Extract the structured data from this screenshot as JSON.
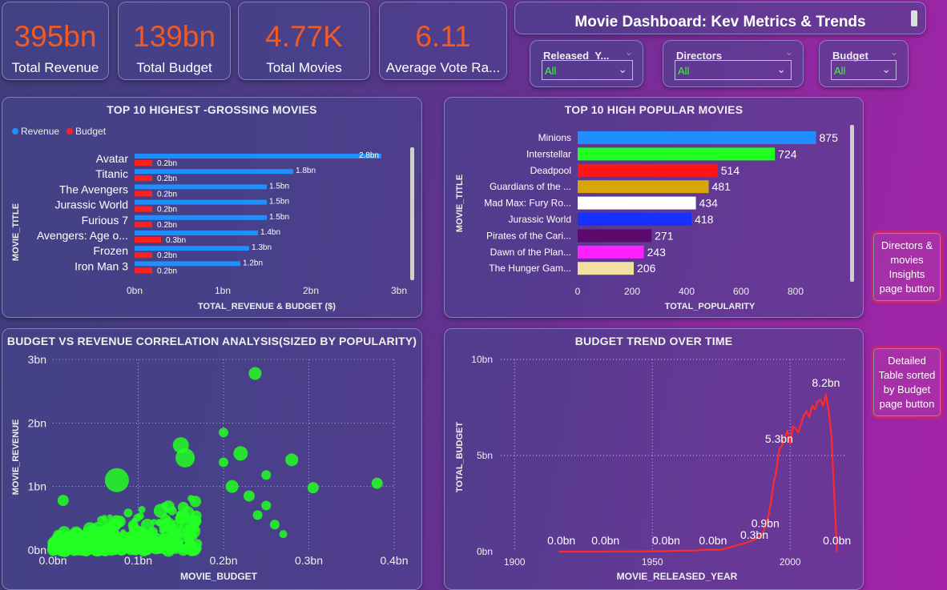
{
  "kpis": [
    {
      "value": "395bn",
      "label": "Total Revenue"
    },
    {
      "value": "139bn",
      "label": "Total Budget"
    },
    {
      "value": "4.77K",
      "label": "Total Movies"
    },
    {
      "value": "6.11",
      "label": "Average Vote Ra..."
    }
  ],
  "header": {
    "title": "Movie Dashboard: Kev Metrics & Trends"
  },
  "slicers": [
    {
      "title": "Released_Y...",
      "value": "All"
    },
    {
      "title": "Directors",
      "value": "All"
    },
    {
      "title": "Budget",
      "value": "All"
    }
  ],
  "nav_buttons": {
    "directors": "Directors & movies Insights page button",
    "detailed": "Detailed Table sorted by Budget page button"
  },
  "chart_data": [
    {
      "type": "bar",
      "title": "TOP 10 HIGHEST -GROSSING MOVIES",
      "legend": [
        {
          "name": "Revenue",
          "color": "#1f8fff"
        },
        {
          "name": "Budget",
          "color": "#ff2020"
        }
      ],
      "legend_position": "top-left",
      "ylabel": "MOVIE_TITLE",
      "xlabel": "TOTAL_REVENUE & BUDGET ($)",
      "xlim": [
        0,
        3
      ],
      "xticks": [
        "0bn",
        "1bn",
        "2bn",
        "3bn"
      ],
      "categories": [
        "Avatar",
        "Titanic",
        "The Avengers",
        "Jurassic World",
        "Furious 7",
        "Avengers: Age o...",
        "Frozen",
        "Iron Man 3"
      ],
      "series": [
        {
          "name": "Revenue",
          "color": "#1f8fff",
          "values": [
            2.8,
            1.8,
            1.5,
            1.5,
            1.5,
            1.4,
            1.3,
            1.2
          ],
          "labels": [
            "2.8bn",
            "1.8bn",
            "1.5bn",
            "1.5bn",
            "1.5bn",
            "1.4bn",
            "1.3bn",
            "1.2bn"
          ]
        },
        {
          "name": "Budget",
          "color": "#ff2020",
          "values": [
            0.2,
            0.2,
            0.2,
            0.2,
            0.2,
            0.3,
            0.2,
            0.2
          ],
          "labels": [
            "0.2bn",
            "0.2bn",
            "0.2bn",
            "0.2bn",
            "0.2bn",
            "0.3bn",
            "0.2bn",
            "0.2bn"
          ]
        }
      ]
    },
    {
      "type": "bar",
      "title": "TOP 10 HIGH POPULAR MOVIES",
      "ylabel": "MOVIE_TITLE",
      "xlabel": "TOTAL_POPULARITY",
      "xlim": [
        0,
        900
      ],
      "xticks": [
        "0",
        "200",
        "400",
        "600",
        "800"
      ],
      "categories": [
        "Minions",
        "Interstellar",
        "Deadpool",
        "Guardians of the ...",
        "Mad Max: Fury Ro...",
        "Jurassic World",
        "Pirates of the Cari...",
        "Dawn of the Plan...",
        "The Hunger Gam..."
      ],
      "values": [
        875,
        724,
        514,
        481,
        434,
        418,
        271,
        243,
        206
      ],
      "colors": [
        "#1f8fff",
        "#22ff22",
        "#ff1515",
        "#d9a60a",
        "#ffffff",
        "#1530ff",
        "#5a0a6a",
        "#ff20ff",
        "#f2e0a0"
      ]
    },
    {
      "type": "scatter",
      "title": "BUDGET VS REVENUE CORRELATION ANALYSIS(SIZED BY POPULARITY)",
      "xlabel": "MOVIE_BUDGET",
      "ylabel": "MOVIE_REVENUE",
      "xlim": [
        0,
        0.4
      ],
      "ylim": [
        0,
        3
      ],
      "xticks": [
        "0.0bn",
        "0.1bn",
        "0.2bn",
        "0.3bn",
        "0.4bn"
      ],
      "yticks": [
        "0bn",
        "1bn",
        "2bn",
        "3bn"
      ],
      "grid": true,
      "color": "#22ff22",
      "points": [
        {
          "x": 0.237,
          "y": 2.78,
          "s": 8
        },
        {
          "x": 0.2,
          "y": 1.85,
          "s": 6
        },
        {
          "x": 0.22,
          "y": 1.52,
          "s": 9
        },
        {
          "x": 0.28,
          "y": 1.42,
          "s": 8
        },
        {
          "x": 0.38,
          "y": 1.05,
          "s": 7
        },
        {
          "x": 0.305,
          "y": 0.98,
          "s": 7
        },
        {
          "x": 0.25,
          "y": 1.18,
          "s": 6
        },
        {
          "x": 0.15,
          "y": 1.65,
          "s": 10
        },
        {
          "x": 0.155,
          "y": 1.45,
          "s": 12
        },
        {
          "x": 0.075,
          "y": 1.1,
          "s": 15
        },
        {
          "x": 0.21,
          "y": 1.0,
          "s": 8
        },
        {
          "x": 0.25,
          "y": 0.7,
          "s": 6
        },
        {
          "x": 0.26,
          "y": 0.4,
          "s": 6
        },
        {
          "x": 0.2,
          "y": 1.38,
          "s": 6
        },
        {
          "x": 0.012,
          "y": 0.78,
          "s": 7
        },
        {
          "x": 0.27,
          "y": 0.25,
          "s": 5
        },
        {
          "x": 0.24,
          "y": 0.55,
          "s": 6
        },
        {
          "x": 0.23,
          "y": 0.85,
          "s": 7
        }
      ]
    },
    {
      "type": "line",
      "title": "BUDGET TREND OVER TIME",
      "xlabel": "MOVIE_RELEASED_YEAR",
      "ylabel": "TOTAL_BUDGET",
      "xlim": [
        1895,
        2020
      ],
      "ylim": [
        0,
        10
      ],
      "xticks": [
        1900,
        1950,
        2000
      ],
      "yticks": [
        "0bn",
        "5bn",
        "10bn"
      ],
      "grid": true,
      "color": "#ff2a2a",
      "x": [
        1916,
        1925,
        1930,
        1935,
        1940,
        1945,
        1950,
        1955,
        1960,
        1965,
        1970,
        1975,
        1980,
        1985,
        1988,
        1990,
        1992,
        1993,
        1994,
        1995,
        1996,
        1997,
        1998,
        1999,
        2000,
        2001,
        2002,
        2003,
        2004,
        2005,
        2006,
        2007,
        2008,
        2009,
        2010,
        2011,
        2012,
        2013,
        2014,
        2015,
        2016,
        2017
      ],
      "values": [
        0.0,
        0.0,
        0.0,
        0.01,
        0.01,
        0.01,
        0.02,
        0.02,
        0.05,
        0.05,
        0.1,
        0.1,
        0.3,
        0.5,
        0.7,
        0.9,
        1.8,
        2.5,
        3.6,
        4.2,
        5.3,
        5.5,
        5.9,
        6.3,
        5.6,
        6.5,
        6.4,
        6.2,
        6.7,
        7.1,
        7.3,
        7.0,
        7.6,
        7.4,
        7.8,
        7.9,
        7.6,
        8.2,
        7.3,
        6.0,
        3.0,
        0.0
      ],
      "annotations": [
        {
          "x": 1917,
          "y": 0.0,
          "label": "0.0bn"
        },
        {
          "x": 1933,
          "y": 0.0,
          "label": "0.0bn"
        },
        {
          "x": 1955,
          "y": 0.0,
          "label": "0.0bn"
        },
        {
          "x": 1972,
          "y": 0.0,
          "label": "0.0bn"
        },
        {
          "x": 1987,
          "y": 0.3,
          "label": "0.3bn"
        },
        {
          "x": 1991,
          "y": 0.9,
          "label": "0.9bn"
        },
        {
          "x": 1996,
          "y": 5.3,
          "label": "5.3bn"
        },
        {
          "x": 2013,
          "y": 8.2,
          "label": "8.2bn"
        },
        {
          "x": 2017,
          "y": 0.0,
          "label": "0.0bn"
        }
      ]
    }
  ]
}
